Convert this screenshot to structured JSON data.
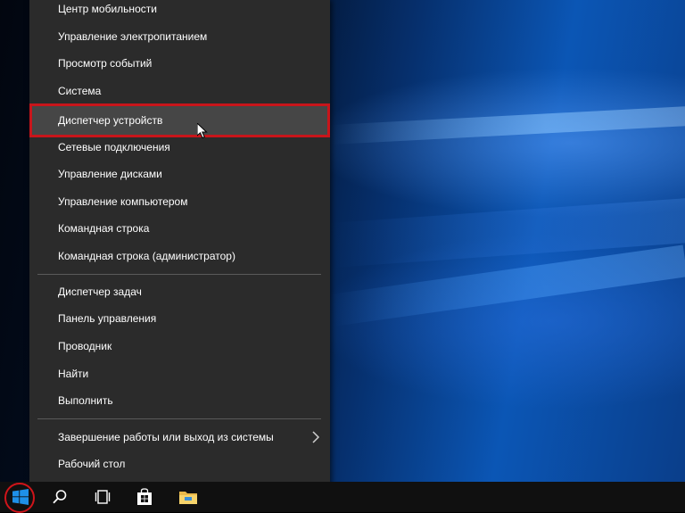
{
  "menu": {
    "items": [
      {
        "label": "Центр мобильности"
      },
      {
        "label": "Управление электропитанием"
      },
      {
        "label": "Просмотр событий"
      },
      {
        "label": "Система"
      },
      {
        "label": "Диспетчер устройств"
      },
      {
        "label": "Сетевые подключения"
      },
      {
        "label": "Управление дисками"
      },
      {
        "label": "Управление компьютером"
      },
      {
        "label": "Командная строка"
      },
      {
        "label": "Командная строка (администратор)"
      },
      {
        "label": "Диспетчер задач"
      },
      {
        "label": "Панель управления"
      },
      {
        "label": "Проводник"
      },
      {
        "label": "Найти"
      },
      {
        "label": "Выполнить"
      },
      {
        "label": "Завершение работы или выход из системы"
      },
      {
        "label": "Рабочий стол"
      }
    ],
    "highlighted_index": 4
  },
  "taskbar": {
    "icons": [
      "windows-start-icon",
      "search-icon",
      "task-view-icon",
      "store-icon",
      "file-explorer-icon"
    ]
  },
  "colors": {
    "menu_bg": "#2b2b2b",
    "highlight_bg": "#464646",
    "highlight_border": "#c8151b",
    "taskbar_bg": "#101010",
    "windows_blue": "#1e90e8"
  }
}
